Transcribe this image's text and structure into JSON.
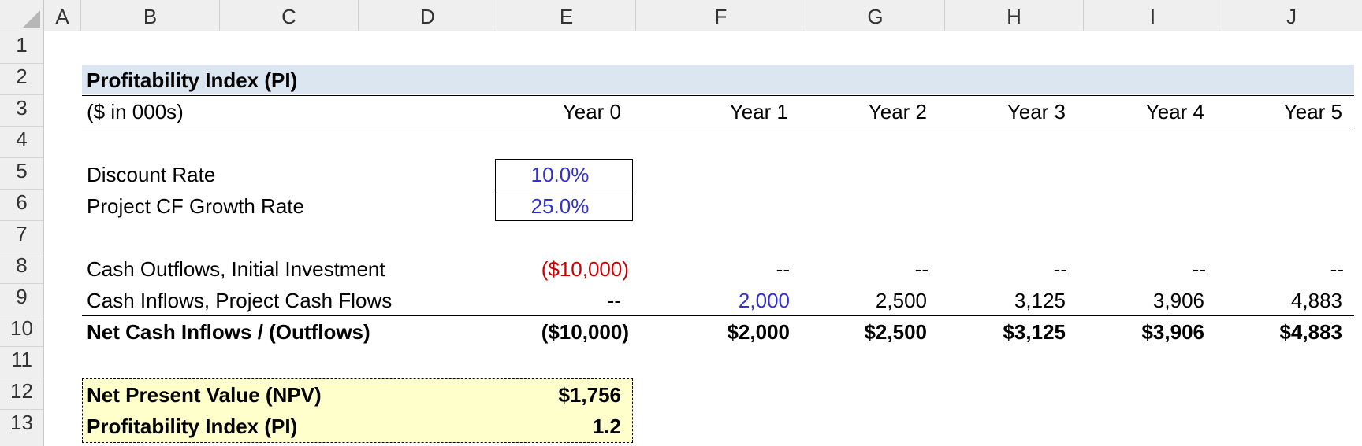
{
  "columns": [
    "A",
    "B",
    "C",
    "D",
    "E",
    "F",
    "G",
    "H",
    "I",
    "J"
  ],
  "rows": [
    "1",
    "2",
    "3",
    "4",
    "5",
    "6",
    "7",
    "8",
    "9",
    "10",
    "11",
    "12",
    "13"
  ],
  "sheet": {
    "title": "Profitability Index (PI)",
    "units": "($ in 000s)",
    "years": [
      "Year 0",
      "Year 1",
      "Year 2",
      "Year 3",
      "Year 4",
      "Year 5"
    ],
    "inputs": {
      "discount_rate_label": "Discount Rate",
      "discount_rate_value": "10.0%",
      "growth_rate_label": "Project CF Growth Rate",
      "growth_rate_value": "25.0%"
    },
    "outflows": {
      "label": "Cash Outflows, Initial Investment",
      "values": [
        "($10,000)",
        "--",
        "--",
        "--",
        "--",
        "--"
      ]
    },
    "inflows": {
      "label": "Cash Inflows, Project Cash Flows",
      "values": [
        "--",
        "2,000",
        "2,500",
        "3,125",
        "3,906",
        "4,883"
      ]
    },
    "net": {
      "label": "Net Cash Inflows / (Outflows)",
      "values": [
        "($10,000)",
        "$2,000",
        "$2,500",
        "$3,125",
        "$3,906",
        "$4,883"
      ]
    },
    "results": {
      "npv_label": "Net Present Value (NPV)",
      "npv_value": "$1,756",
      "pi_label": "Profitability Index (PI)",
      "pi_value": "1.2"
    }
  },
  "colors": {
    "input_font": "#3333cc",
    "negative_font": "#cc0000",
    "title_fill": "#dce6f1",
    "result_fill": "#ffffcc"
  }
}
